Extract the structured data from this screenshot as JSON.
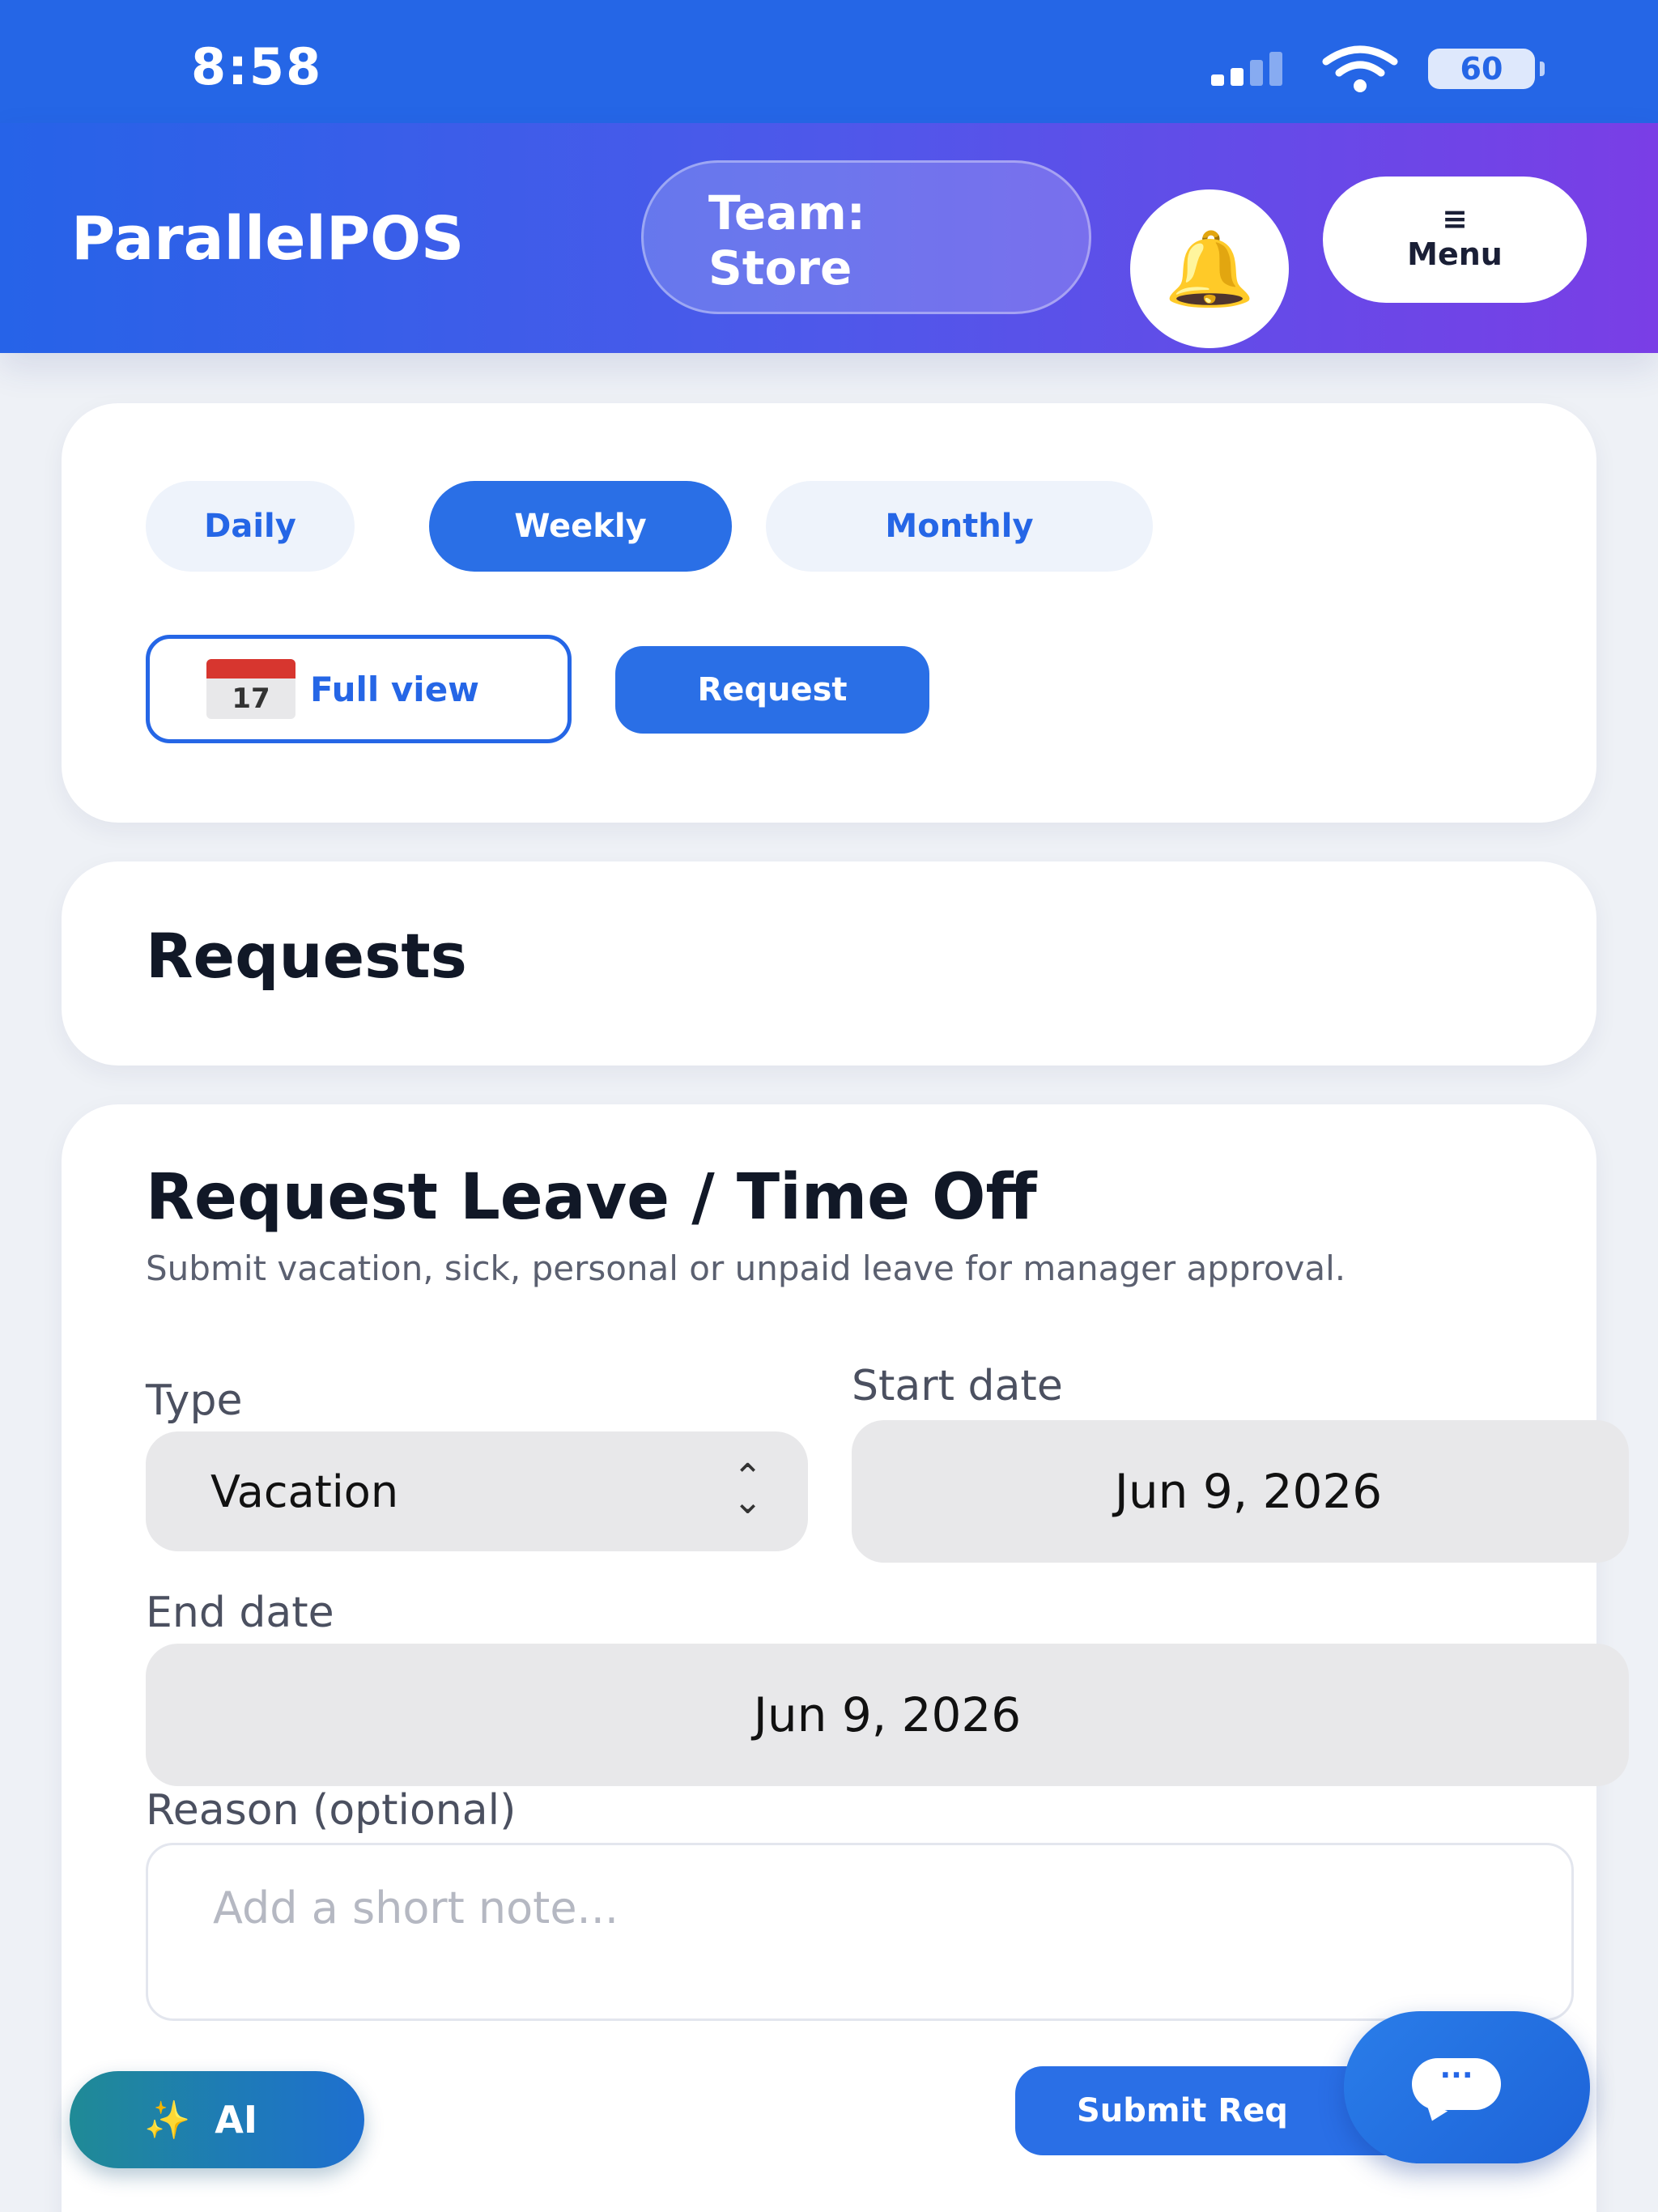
{
  "status_bar": {
    "time": "8:58",
    "battery": "60"
  },
  "header": {
    "app_name": "ParallelPOS",
    "team_line1": "Team:",
    "team_line2": "Store",
    "bell_icon": "bell-icon",
    "menu_glyph": "≡",
    "menu_label": "Menu"
  },
  "schedule": {
    "tabs": [
      {
        "label": "Daily",
        "active": false
      },
      {
        "label": "Weekly",
        "active": true
      },
      {
        "label": "Monthly",
        "active": false
      }
    ],
    "full_view_label": "Full view",
    "calendar_day": "17",
    "request_label": "Request"
  },
  "requests": {
    "title": "Requests"
  },
  "leave_form": {
    "title": "Request Leave / Time Off",
    "subtitle": "Submit vacation, sick, personal or unpaid leave for manager approval.",
    "type_label": "Type",
    "type_value": "Vacation",
    "start_label": "Start date",
    "start_value": "Jun 9, 2026",
    "end_label": "End date",
    "end_value": "Jun 9, 2026",
    "reason_label": "Reason (optional)",
    "reason_placeholder": "Add a short note...",
    "submit_label": "Submit Req"
  },
  "fab": {
    "ai_label": "AI",
    "chat_dots": "···"
  },
  "colors": {
    "primary": "#2566e6",
    "header_end": "#7a3ee6",
    "background": "#eef1f6"
  }
}
